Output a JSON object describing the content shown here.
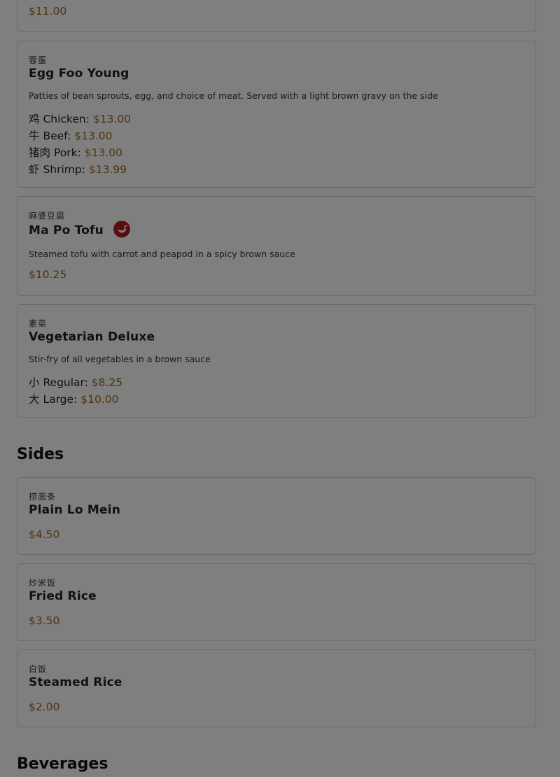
{
  "top_card": {
    "price": "$11.00"
  },
  "egg_foo_young": {
    "chinese": "蓉蛋",
    "name": "Egg Foo Young",
    "description": "Patties of bean sprouts, egg, and choice of meat. Served with a light brown gravy on the side",
    "options": [
      {
        "bullet": "鸡",
        "label": "Chicken:",
        "price": "$13.00"
      },
      {
        "bullet": "牛",
        "label": "Beef:",
        "price": "$13.00"
      },
      {
        "bullet": "猪肉",
        "label": "Pork:",
        "price": "$13.00"
      },
      {
        "bullet": "虾",
        "label": "Shrimp:",
        "price": "$13.99"
      }
    ]
  },
  "ma_po_tofu": {
    "chinese": "麻婆豆腐",
    "name": "Ma Po Tofu",
    "description": "Steamed tofu with carrot and peapod in a spicy brown sauce",
    "price": "$10.25",
    "icon": "chili-pepper-icon",
    "icon_color": "#b51f1f"
  },
  "vegetarian_deluxe": {
    "chinese": "素菜",
    "name": "Vegetarian Deluxe",
    "description": "Stir-fry of all vegetables in a brown sauce",
    "options": [
      {
        "bullet": "小",
        "label": "Regular:",
        "price": "$8.25"
      },
      {
        "bullet": "大",
        "label": "Large:",
        "price": "$10.00"
      }
    ]
  },
  "sides": {
    "title": "Sides",
    "items": [
      {
        "chinese": "捞面条",
        "name": "Plain Lo Mein",
        "price": "$4.50"
      },
      {
        "chinese": "炒米饭",
        "name": "Fried Rice",
        "price": "$3.50"
      },
      {
        "chinese": "白饭",
        "name": "Steamed Rice",
        "price": "$2.00"
      }
    ]
  },
  "beverages": {
    "title": "Beverages"
  },
  "colors": {
    "price": "#9c6a1d",
    "card_border": "#d5d5d5",
    "overlay": "rgba(0,0,0,0.5)"
  }
}
